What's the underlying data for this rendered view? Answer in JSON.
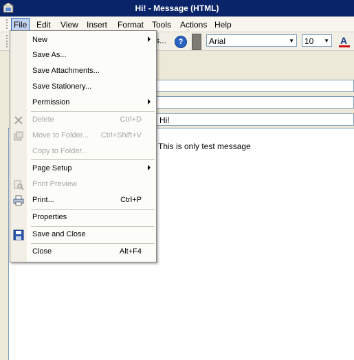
{
  "window": {
    "title": "Hi! - Message (HTML)"
  },
  "menubar": {
    "items": [
      "File",
      "Edit",
      "View",
      "Insert",
      "Format",
      "Tools",
      "Actions",
      "Help"
    ]
  },
  "toolbar": {
    "partial_label": "s...",
    "help_icon_glyph": "?",
    "font_name": "Arial",
    "font_size": "10",
    "font_color": "#d01010"
  },
  "message": {
    "subject": "Hi!",
    "body": "This is only test message"
  },
  "file_menu": {
    "items": [
      {
        "label": "New",
        "shortcut": "",
        "submenu": true,
        "enabled": true,
        "icon": ""
      },
      {
        "label": "Save As...",
        "shortcut": "",
        "submenu": false,
        "enabled": true,
        "icon": ""
      },
      {
        "label": "Save Attachments...",
        "shortcut": "",
        "submenu": false,
        "enabled": true,
        "icon": ""
      },
      {
        "label": "Save Stationery...",
        "shortcut": "",
        "submenu": false,
        "enabled": true,
        "icon": ""
      },
      {
        "label": "Permission",
        "shortcut": "",
        "submenu": true,
        "enabled": true,
        "icon": ""
      },
      {
        "label": "Delete",
        "shortcut": "Ctrl+D",
        "submenu": false,
        "enabled": false,
        "icon": "delete-x-icon"
      },
      {
        "label": "Move to Folder...",
        "shortcut": "Ctrl+Shift+V",
        "submenu": false,
        "enabled": false,
        "icon": "move-to-folder-icon"
      },
      {
        "label": "Copy to Folder...",
        "shortcut": "",
        "submenu": false,
        "enabled": false,
        "icon": ""
      },
      {
        "label": "Page Setup",
        "shortcut": "",
        "submenu": true,
        "enabled": true,
        "icon": ""
      },
      {
        "label": "Print Preview",
        "shortcut": "",
        "submenu": false,
        "enabled": false,
        "icon": "print-preview-icon"
      },
      {
        "label": "Print...",
        "shortcut": "Ctrl+P",
        "submenu": false,
        "enabled": true,
        "icon": "printer-icon"
      },
      {
        "label": "Properties",
        "shortcut": "",
        "submenu": false,
        "enabled": true,
        "icon": ""
      },
      {
        "label": "Save and Close",
        "shortcut": "",
        "submenu": false,
        "enabled": true,
        "icon": "floppy-disk-icon"
      },
      {
        "label": "Close",
        "shortcut": "Alt+F4",
        "submenu": false,
        "enabled": true,
        "icon": ""
      }
    ]
  }
}
